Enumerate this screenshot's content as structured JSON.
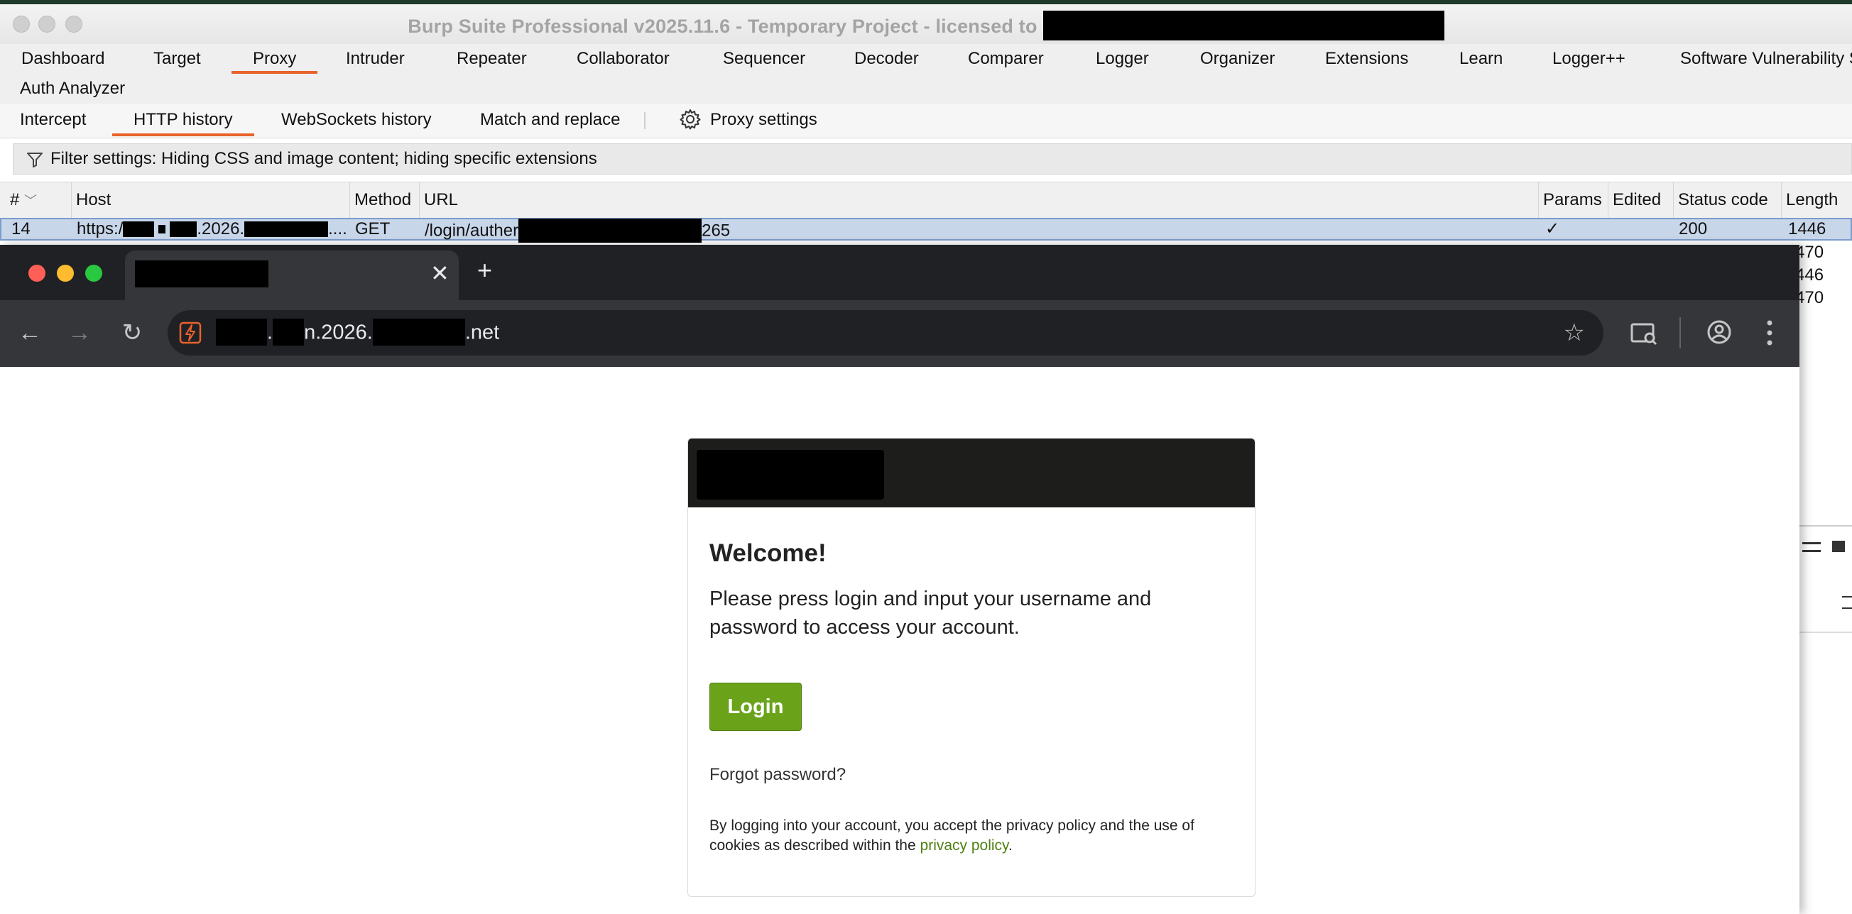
{
  "burp": {
    "title": "Burp Suite Professional v2025.11.6 - Temporary Project - licensed to",
    "menu": [
      "Dashboard",
      "Target",
      "Proxy",
      "Intruder",
      "Repeater",
      "Collaborator",
      "Sequencer",
      "Decoder",
      "Comparer",
      "Logger",
      "Organizer",
      "Extensions",
      "Learn",
      "Logger++",
      "Software Vulnerability S"
    ],
    "menu_row2": [
      "Auth Analyzer"
    ],
    "active_menu": "Proxy",
    "subtabs": [
      "Intercept",
      "HTTP history",
      "WebSockets history",
      "Match and replace"
    ],
    "active_subtab": "HTTP history",
    "proxy_settings": "Proxy settings",
    "filter": "Filter settings: Hiding CSS and image content; hiding specific extensions",
    "columns": [
      "#",
      "Host",
      "Method",
      "URL",
      "Params",
      "Edited",
      "Status code",
      "Length"
    ],
    "selected_row": {
      "num": "14",
      "host_prefix": "https:/",
      "host_mid": ".2026.",
      "host_suffix": "....",
      "method": "GET",
      "url_prefix": "/login/auther",
      "url_suffix": "265",
      "params": "✓",
      "status": "200",
      "length": "1446"
    },
    "background_lengths": [
      "470",
      "446",
      "470"
    ],
    "accent": "#e8632b"
  },
  "chrome": {
    "url_mid": ".2026.",
    "url_mid_prefix": "n",
    "url_tld": ".net",
    "tab_close": "✕",
    "new_tab": "+",
    "nav": {
      "back": "←",
      "forward": "→",
      "reload": "↻"
    },
    "star": "☆"
  },
  "login_card": {
    "welcome": "Welcome!",
    "prompt": "Please press login and input your username and password to access your account.",
    "login_button": "Login",
    "forgot": "Forgot password?",
    "legal_text": "By logging into your account, you accept the privacy policy and the use of cookies as described within the",
    "privacy_link": "privacy policy",
    "legal_end": ".",
    "button_color": "#6aa31a",
    "link_color": "#4d7f12"
  }
}
